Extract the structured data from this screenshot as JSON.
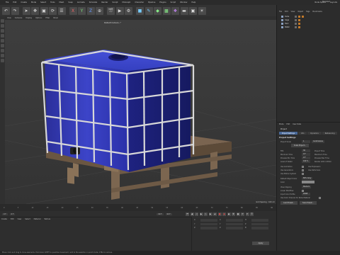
{
  "window": {
    "layout_label": "Standard"
  },
  "menubar": {
    "items": [
      "File",
      "Edit",
      "Create",
      "Mode",
      "Select",
      "Tools",
      "Mesh",
      "Snap",
      "Animate",
      "Simulate",
      "Render",
      "Sculpt",
      "MoGraph",
      "Character",
      "Pipeline",
      "Plugins",
      "Script",
      "Window",
      "Help"
    ],
    "right": [
      "Node Space",
      "Layouts"
    ]
  },
  "toolbar": {
    "icons": [
      "undo-icon",
      "redo-icon",
      "live-selection-icon",
      "move-icon",
      "scale-icon",
      "rotate-icon",
      "recent-icon",
      "x-axis-icon",
      "y-axis-icon",
      "z-axis-icon",
      "coord-icon",
      "render-view-icon",
      "render-icon",
      "edit-render-icon",
      "cube-icon",
      "pen-icon",
      "subdivision-icon",
      "cloner-icon",
      "deformer-icon",
      "floor-icon",
      "camera-icon",
      "light-icon"
    ]
  },
  "viewport": {
    "menu": [
      "View",
      "Cameras",
      "Display",
      "Options",
      "Filter",
      "Panel"
    ],
    "camera_label": "Default Camera •°",
    "grid_label": "Grid Spacing : 100 cm"
  },
  "timeline": {
    "ticks": [
      "0",
      "5",
      "10",
      "15",
      "20",
      "25",
      "30",
      "35",
      "40",
      "45",
      "50",
      "55",
      "60",
      "65",
      "70",
      "75",
      "80",
      "85",
      "90"
    ],
    "end_label": "0 F"
  },
  "controls": {
    "frame_start": "0 F",
    "frame_cur": "0 F",
    "frame_end": "90 F",
    "frame_max": "90 F"
  },
  "material_panel": {
    "menu": [
      "Create",
      "Edit",
      "View",
      "Select",
      "Material",
      "Texture"
    ]
  },
  "coord_panel": {
    "rows": [
      {
        "a": "X",
        "b": "X",
        "c": "H"
      },
      {
        "a": "Y",
        "b": "Y",
        "c": "P"
      },
      {
        "a": "Z",
        "b": "Z",
        "c": "B"
      }
    ],
    "apply_label": "Apply"
  },
  "object_panel": {
    "menu": [
      "File",
      "Edit",
      "View",
      "Object",
      "Tags",
      "Bookmarks"
    ],
    "objects": [
      {
        "name": "Cube"
      },
      {
        "name": "Cage"
      },
      {
        "name": "Tank"
      },
      {
        "name": "Pallet"
      }
    ]
  },
  "attribute_panel": {
    "menu": [
      "Mode",
      "Edit",
      "User Data"
    ],
    "title": "Project",
    "tabs": [
      "Project Settings",
      "Info",
      "Dynamics",
      "Referencing"
    ],
    "active_tab": 0,
    "section": "Project Settings",
    "rows": [
      {
        "label": "Project Scale",
        "value": "1",
        "right": "Centimeters"
      },
      {
        "label": "Scale Project...",
        "value": "",
        "right": ""
      },
      {
        "label": "FPS",
        "value": "30",
        "right": "Project Time"
      },
      {
        "label": "Minimum Time",
        "value": "0 F",
        "right": "Maximum Time"
      },
      {
        "label": "Preview Min Time",
        "value": "0 F",
        "right": "Preview Max Time"
      },
      {
        "label": "Level of Detail",
        "value": "100 %",
        "right": "Render LOD in Editor"
      },
      {
        "label": "Use Animation",
        "value": "",
        "right": "Use Expression"
      },
      {
        "label": "Use Generators",
        "value": "",
        "right": "Use Deformers"
      },
      {
        "label": "Use Motion System",
        "value": "",
        "right": ""
      },
      {
        "label": "Default Object Color",
        "value": "80% Gray",
        "right": ""
      },
      {
        "label": "Color",
        "value": "",
        "right": ""
      },
      {
        "label": "View Clipping",
        "value": "Medium",
        "right": ""
      },
      {
        "label": "Linear Workflow",
        "value": "",
        "right": ""
      },
      {
        "label": "Input Color Profile",
        "value": "sRGB",
        "right": ""
      },
      {
        "label": "Use Color Channel for Node Material",
        "value": "",
        "right": ""
      }
    ],
    "buttons": [
      "Load Preset...",
      "Save Preset..."
    ]
  },
  "status": {
    "text": "Move: Click and drag to move elements. Hold down SHIFT to quantize movement / add to the selection in point mode, CTRL to remove."
  }
}
